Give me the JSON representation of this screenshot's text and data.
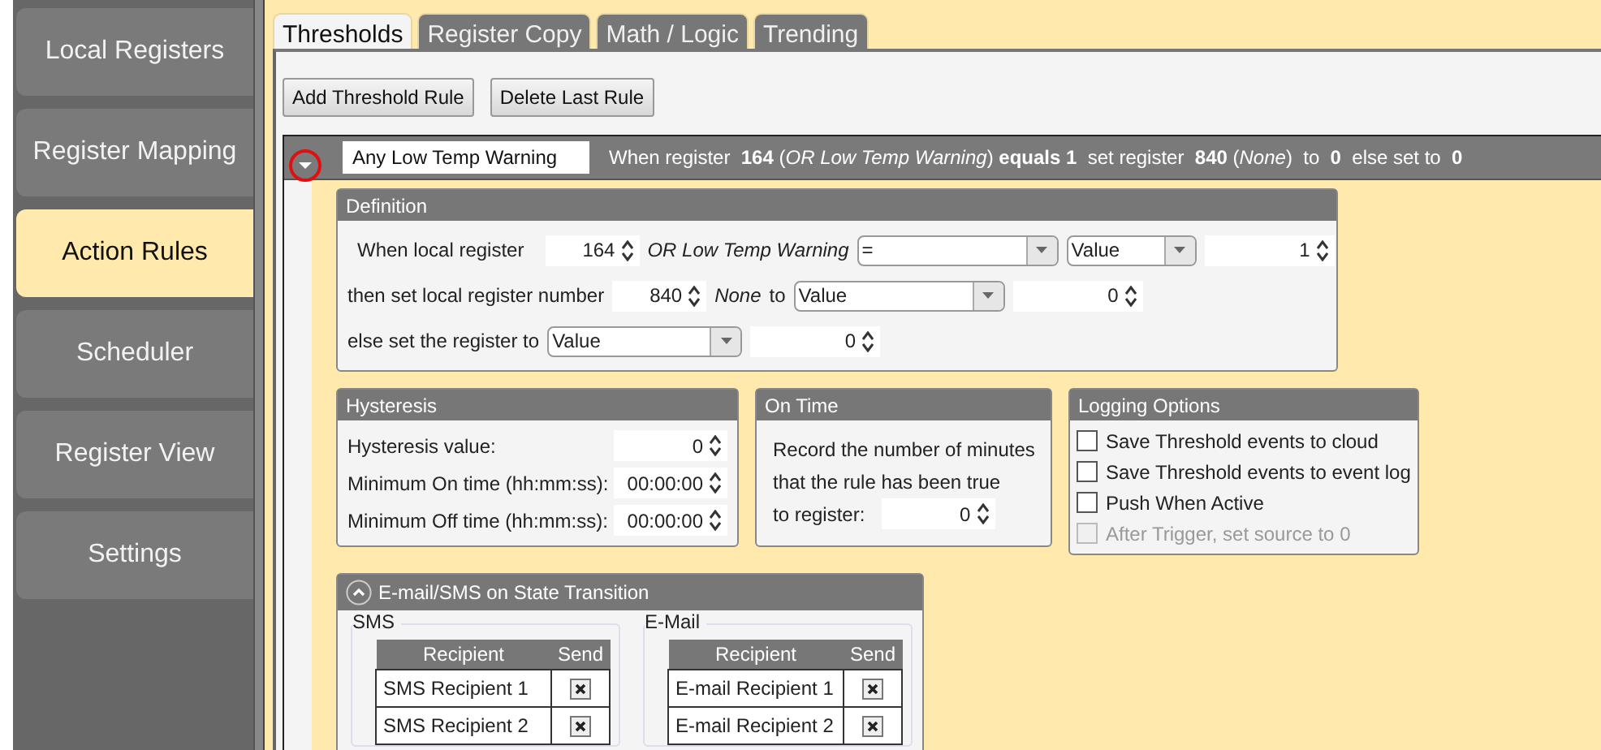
{
  "sidebar": {
    "items": [
      {
        "label": "Local Registers",
        "selected": false
      },
      {
        "label": "Register Mapping",
        "selected": false
      },
      {
        "label": "Action Rules",
        "selected": true
      },
      {
        "label": "Scheduler",
        "selected": false
      },
      {
        "label": "Register View",
        "selected": false
      },
      {
        "label": "Settings",
        "selected": false
      }
    ]
  },
  "tabs": [
    {
      "label": "Thresholds",
      "selected": true
    },
    {
      "label": "Register Copy",
      "selected": false
    },
    {
      "label": "Math / Logic",
      "selected": false
    },
    {
      "label": "Trending",
      "selected": false
    }
  ],
  "buttons": [
    "Add Threshold Rule",
    "Delete Last Rule"
  ],
  "rule": {
    "expanded": true,
    "name": "Any Low Temp Warning",
    "summary": "When register  **164** (*OR Low Temp Warning*) **equals 1**  set register  **840** (*None*)  to  **0**  else set to  **0**",
    "definition": {
      "title": "Definition",
      "when_label": "When local register",
      "register": "164",
      "register_name": "OR Low Temp Warning",
      "operator": "=",
      "compare_type": "Value",
      "compare_value": "1",
      "then_label": "then set local register number",
      "target_register": "840",
      "target_name": "None",
      "to_label": "to",
      "set_type": "Value",
      "set_value": "0",
      "else_label": "else set the register to",
      "else_type": "Value",
      "else_value": "0"
    },
    "hysteresis": {
      "title": "Hysteresis",
      "fields": [
        {
          "label": "Hysteresis value:",
          "value": "0"
        },
        {
          "label": "Minimum On time (hh:mm:ss):",
          "value": "00:00:00"
        },
        {
          "label": "Minimum Off time (hh:mm:ss):",
          "value": "00:00:00"
        }
      ]
    },
    "on_time": {
      "title": "On Time",
      "text": "Record the number of minutes that the rule has been true",
      "field_label": "to register:",
      "value": "0"
    },
    "logging": {
      "title": "Logging Options",
      "options": [
        {
          "label": "Save Threshold events to cloud",
          "checked": false,
          "disabled": false
        },
        {
          "label": "Save Threshold events to event log",
          "checked": false,
          "disabled": false
        },
        {
          "label": "Push When Active",
          "checked": false,
          "disabled": false
        },
        {
          "label": "After Trigger, set source to 0",
          "checked": false,
          "disabled": true
        }
      ]
    },
    "notifications": {
      "title": "E-mail/SMS on State Transition",
      "expanded": true,
      "groups": [
        {
          "title": "SMS",
          "columns": [
            "Recipient",
            "Send"
          ],
          "rows": [
            {
              "recipient": "SMS Recipient 1",
              "send": true
            },
            {
              "recipient": "SMS Recipient 2",
              "send": true
            }
          ]
        },
        {
          "title": "E-Mail",
          "columns": [
            "Recipient",
            "Send"
          ],
          "rows": [
            {
              "recipient": "E-mail Recipient 1",
              "send": true
            },
            {
              "recipient": "E-mail Recipient 2",
              "send": true
            }
          ]
        }
      ]
    }
  }
}
